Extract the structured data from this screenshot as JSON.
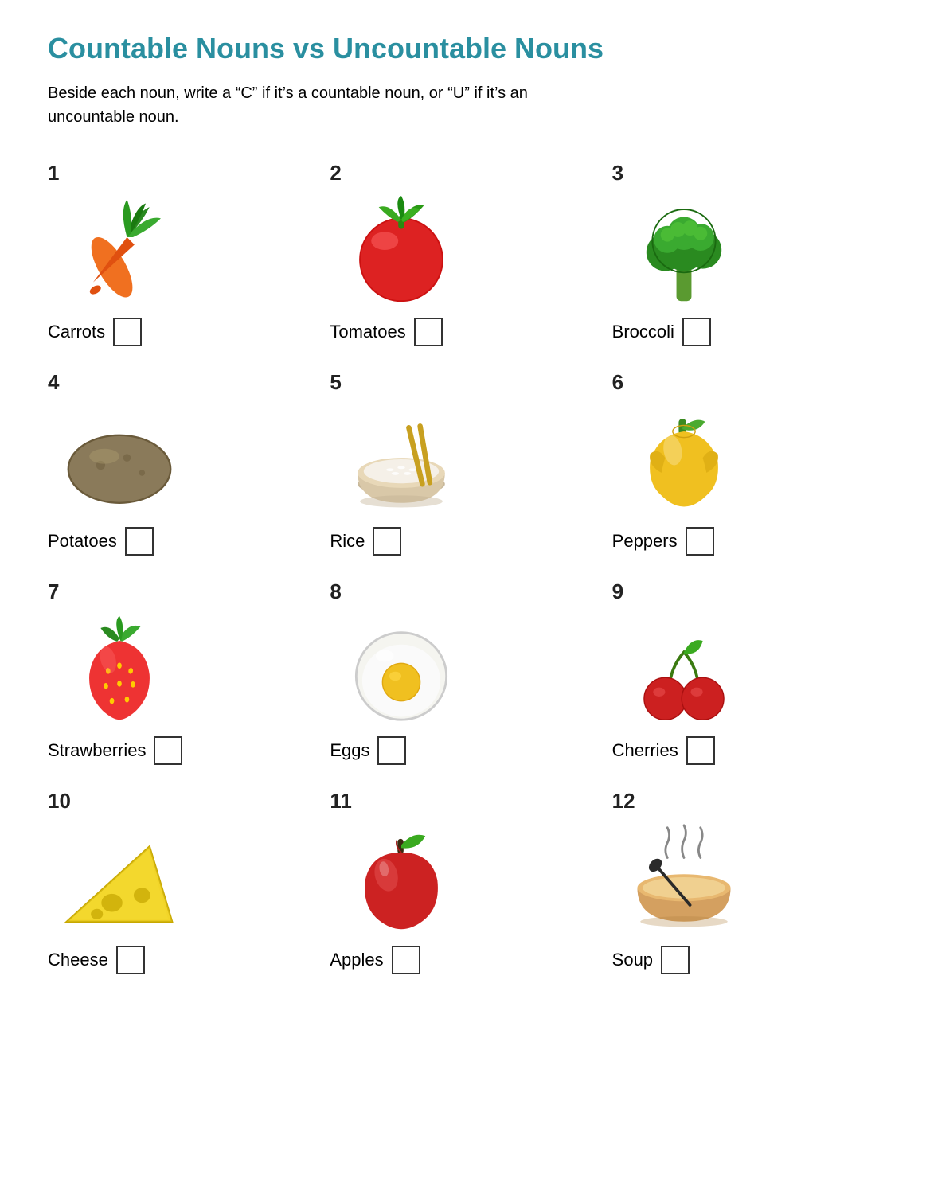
{
  "title": "Countable Nouns vs Uncountable Nouns",
  "instructions": "Beside each noun, write a “C” if it’s a countable noun, or “U” if it’s an uncountable noun.",
  "items": [
    {
      "number": "1",
      "label": "Carrots"
    },
    {
      "number": "2",
      "label": "Tomatoes"
    },
    {
      "number": "3",
      "label": "Broccoli"
    },
    {
      "number": "4",
      "label": "Potatoes"
    },
    {
      "number": "5",
      "label": "Rice"
    },
    {
      "number": "6",
      "label": "Peppers"
    },
    {
      "number": "7",
      "label": "Strawberries"
    },
    {
      "number": "8",
      "label": "Eggs"
    },
    {
      "number": "9",
      "label": "Cherries"
    },
    {
      "number": "10",
      "label": "Cheese"
    },
    {
      "number": "11",
      "label": "Apples"
    },
    {
      "number": "12",
      "label": "Soup"
    }
  ]
}
